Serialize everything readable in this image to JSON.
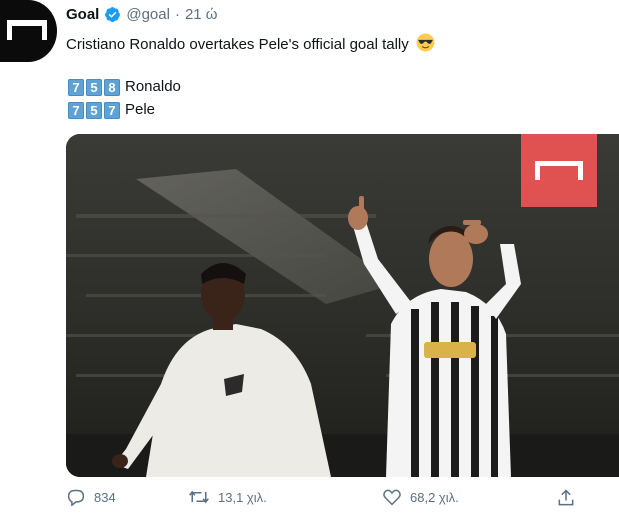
{
  "tweet": {
    "author_name": "Goal",
    "handle": "@goal",
    "separator": "·",
    "time": "21 ώ",
    "text": "Cristiano Ronaldo overtakes Pele's official goal tally",
    "emoji": "sunglasses-emoji",
    "scores": [
      {
        "digits": [
          "7",
          "5",
          "8"
        ],
        "name": "Ronaldo"
      },
      {
        "digits": [
          "7",
          "5",
          "7"
        ],
        "name": "Pele"
      }
    ],
    "media": {
      "description_icon": "goal-logo-icon",
      "jersey_sponsor": "Jeep"
    },
    "actions": {
      "reply_count": "834",
      "retweet_count": "13,1 χιλ.",
      "like_count": "68,2 χιλ."
    }
  },
  "colors": {
    "accent": "#1d9bf0",
    "muted": "#5b7083",
    "keycap": "#5ea2d6",
    "brand_red": "#e05252"
  }
}
